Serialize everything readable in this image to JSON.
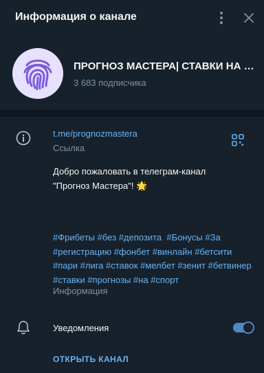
{
  "colors": {
    "background": "#17212b",
    "divider": "#0e1621",
    "accent": "#6ab3f3",
    "muted": "#7f91a4",
    "toggle": "#5288c1"
  },
  "header": {
    "title": "Информация о канале",
    "more_icon": "more-vertical-icon",
    "close_icon": "close-icon"
  },
  "channel": {
    "name": "ПРОГНОЗ МАСТЕРА| СТАВКИ НА СПОРТ",
    "subscribers": "3 683 подписчика",
    "avatar_icon": "fingerprint-icon"
  },
  "link": {
    "icon": "info-icon",
    "url": "t.me/prognozmastera",
    "caption": "Ссылка",
    "qr_icon": "qr-code-icon"
  },
  "description": {
    "line1": "Добро пожаловать в телеграм-канал",
    "line2": "\"Прогноз Мастера\"!",
    "emoji": "🌟",
    "hashtags": [
      "#Фрибеты",
      "#без",
      "#депозита",
      "#Бонусы",
      "#За",
      "#регистрацию",
      "#фонбет",
      "#винлайн",
      "#бетсити",
      "#пари",
      "#лига",
      "#ставок",
      "#мелбет",
      "#зенит",
      "#бетвинер",
      "#ставки",
      "#прогнозы",
      "#на",
      "#спорт"
    ],
    "caption": "Информация"
  },
  "notifications": {
    "icon": "bell-icon",
    "label": "Уведомления",
    "enabled": true
  },
  "actions": {
    "open_channel": "ОТКРЫТЬ КАНАЛ"
  }
}
